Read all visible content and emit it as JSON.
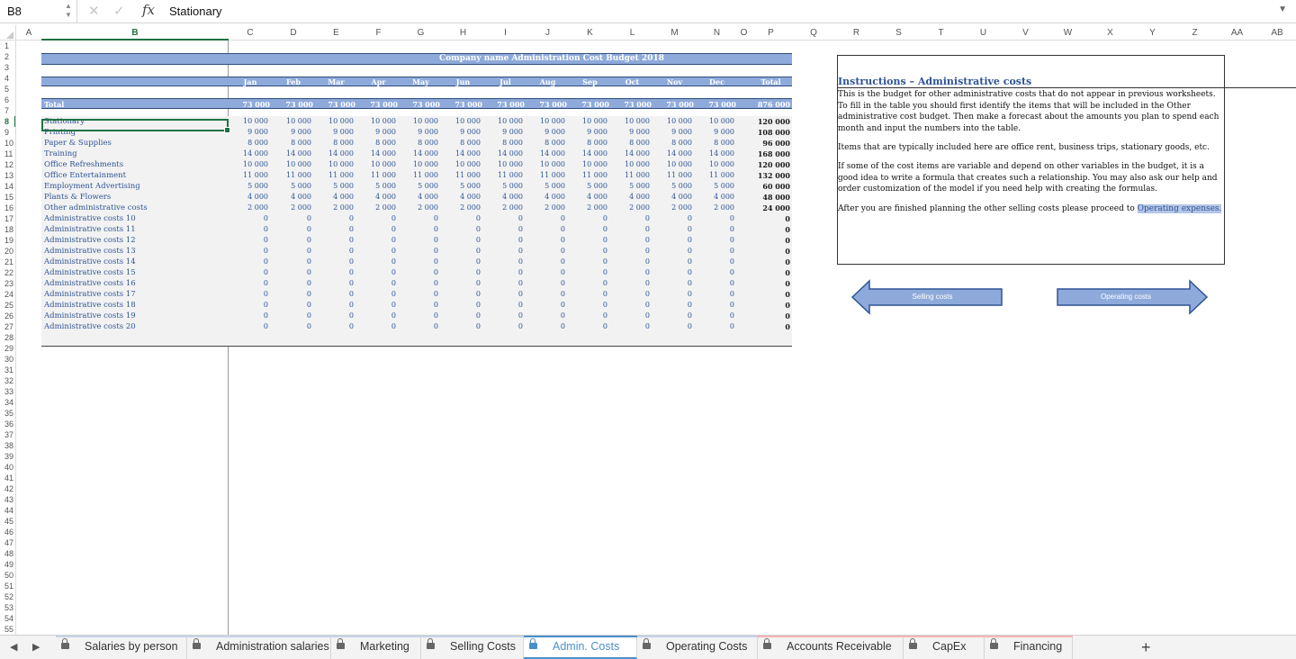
{
  "formula_bar": {
    "name_box": "B8",
    "content": "Stationary",
    "fx": "fx",
    "cancel": "✕",
    "accept": "✓"
  },
  "columns": [
    "A",
    "B",
    "C",
    "D",
    "E",
    "F",
    "G",
    "H",
    "I",
    "J",
    "K",
    "L",
    "M",
    "N",
    "O",
    "P",
    "Q",
    "R",
    "S",
    "T",
    "U",
    "V",
    "W",
    "X",
    "Y",
    "Z",
    "AA",
    "AB"
  ],
  "row_count": 55,
  "selected_cell": {
    "col": "B",
    "row": 8
  },
  "budget": {
    "title": "Company name Administration Cost Budget 2018",
    "months": [
      "Jan",
      "Feb",
      "Mar",
      "Apr",
      "May",
      "Jun",
      "Jul",
      "Aug",
      "Sep",
      "Oct",
      "Nov",
      "Dec"
    ],
    "total_header": "Total",
    "total_row": {
      "label": "Total",
      "values": [
        "73 000",
        "73 000",
        "73 000",
        "73 000",
        "73 000",
        "73 000",
        "73 000",
        "73 000",
        "73 000",
        "73 000",
        "73 000",
        "73 000"
      ],
      "total": "876 000"
    },
    "rows": [
      {
        "label": "Stationary",
        "values": [
          "10 000",
          "10 000",
          "10 000",
          "10 000",
          "10 000",
          "10 000",
          "10 000",
          "10 000",
          "10 000",
          "10 000",
          "10 000",
          "10 000"
        ],
        "total": "120 000"
      },
      {
        "label": "Printing",
        "values": [
          "9 000",
          "9 000",
          "9 000",
          "9 000",
          "9 000",
          "9 000",
          "9 000",
          "9 000",
          "9 000",
          "9 000",
          "9 000",
          "9 000"
        ],
        "total": "108 000"
      },
      {
        "label": "Paper & Supplies",
        "values": [
          "8 000",
          "8 000",
          "8 000",
          "8 000",
          "8 000",
          "8 000",
          "8 000",
          "8 000",
          "8 000",
          "8 000",
          "8 000",
          "8 000"
        ],
        "total": "96 000"
      },
      {
        "label": "Training",
        "values": [
          "14 000",
          "14 000",
          "14 000",
          "14 000",
          "14 000",
          "14 000",
          "14 000",
          "14 000",
          "14 000",
          "14 000",
          "14 000",
          "14 000"
        ],
        "total": "168 000"
      },
      {
        "label": "Office Refreshments",
        "values": [
          "10 000",
          "10 000",
          "10 000",
          "10 000",
          "10 000",
          "10 000",
          "10 000",
          "10 000",
          "10 000",
          "10 000",
          "10 000",
          "10 000"
        ],
        "total": "120 000"
      },
      {
        "label": "Office Entertainment",
        "values": [
          "11 000",
          "11 000",
          "11 000",
          "11 000",
          "11 000",
          "11 000",
          "11 000",
          "11 000",
          "11 000",
          "11 000",
          "11 000",
          "11 000"
        ],
        "total": "132 000"
      },
      {
        "label": "Employment Advertising",
        "values": [
          "5 000",
          "5 000",
          "5 000",
          "5 000",
          "5 000",
          "5 000",
          "5 000",
          "5 000",
          "5 000",
          "5 000",
          "5 000",
          "5 000"
        ],
        "total": "60 000"
      },
      {
        "label": "Plants & Flowers",
        "values": [
          "4 000",
          "4 000",
          "4 000",
          "4 000",
          "4 000",
          "4 000",
          "4 000",
          "4 000",
          "4 000",
          "4 000",
          "4 000",
          "4 000"
        ],
        "total": "48 000"
      },
      {
        "label": "Other administrative costs",
        "values": [
          "2 000",
          "2 000",
          "2 000",
          "2 000",
          "2 000",
          "2 000",
          "2 000",
          "2 000",
          "2 000",
          "2 000",
          "2 000",
          "2 000"
        ],
        "total": "24 000"
      },
      {
        "label": "Administrative costs 10",
        "values": [
          "0",
          "0",
          "0",
          "0",
          "0",
          "0",
          "0",
          "0",
          "0",
          "0",
          "0",
          "0"
        ],
        "total": "0"
      },
      {
        "label": "Administrative costs 11",
        "values": [
          "0",
          "0",
          "0",
          "0",
          "0",
          "0",
          "0",
          "0",
          "0",
          "0",
          "0",
          "0"
        ],
        "total": "0"
      },
      {
        "label": "Administrative costs 12",
        "values": [
          "0",
          "0",
          "0",
          "0",
          "0",
          "0",
          "0",
          "0",
          "0",
          "0",
          "0",
          "0"
        ],
        "total": "0"
      },
      {
        "label": "Administrative costs 13",
        "values": [
          "0",
          "0",
          "0",
          "0",
          "0",
          "0",
          "0",
          "0",
          "0",
          "0",
          "0",
          "0"
        ],
        "total": "0"
      },
      {
        "label": "Administrative costs 14",
        "values": [
          "0",
          "0",
          "0",
          "0",
          "0",
          "0",
          "0",
          "0",
          "0",
          "0",
          "0",
          "0"
        ],
        "total": "0"
      },
      {
        "label": "Administrative costs 15",
        "values": [
          "0",
          "0",
          "0",
          "0",
          "0",
          "0",
          "0",
          "0",
          "0",
          "0",
          "0",
          "0"
        ],
        "total": "0"
      },
      {
        "label": "Administrative costs 16",
        "values": [
          "0",
          "0",
          "0",
          "0",
          "0",
          "0",
          "0",
          "0",
          "0",
          "0",
          "0",
          "0"
        ],
        "total": "0"
      },
      {
        "label": "Administrative costs 17",
        "values": [
          "0",
          "0",
          "0",
          "0",
          "0",
          "0",
          "0",
          "0",
          "0",
          "0",
          "0",
          "0"
        ],
        "total": "0"
      },
      {
        "label": "Administrative costs 18",
        "values": [
          "0",
          "0",
          "0",
          "0",
          "0",
          "0",
          "0",
          "0",
          "0",
          "0",
          "0",
          "0"
        ],
        "total": "0"
      },
      {
        "label": "Administrative costs 19",
        "values": [
          "0",
          "0",
          "0",
          "0",
          "0",
          "0",
          "0",
          "0",
          "0",
          "0",
          "0",
          "0"
        ],
        "total": "0"
      },
      {
        "label": "Administrative costs 20",
        "values": [
          "0",
          "0",
          "0",
          "0",
          "0",
          "0",
          "0",
          "0",
          "0",
          "0",
          "0",
          "0"
        ],
        "total": "0"
      }
    ]
  },
  "instructions": {
    "title": "Instructions – Administrative costs",
    "p1": "This is the budget for other administrative costs that do not appear in previous worksheets. To fill in the table you should first identify the items that will be included in the Other administrative cost budget. Then make a forecast about the amounts you plan to spend each month and input the numbers into the table.",
    "p2": "Items that are typically included here are office rent, business trips, stationary goods, etc.",
    "p3": "If some of the cost items are variable and depend on other variables in the budget, it is a good idea to write a formula that creates such a relationship. You may also ask our help and order customization of the model if you need help with creating the formulas.",
    "p4_prefix": "After you are finished planning the other selling costs please proceed to ",
    "p4_link": "Operating expenses."
  },
  "nav_buttons": {
    "back_label": "Selling costs",
    "forward_label": "Operating costs",
    "fill": "#8eaadb",
    "stroke": "#2f5496"
  },
  "tabs": [
    {
      "label": "Salaries by person",
      "active": false,
      "stripe": "#c7d4ea"
    },
    {
      "label": "Administration salaries",
      "active": false,
      "stripe": "#c7d4ea"
    },
    {
      "label": "Marketing",
      "active": false,
      "stripe": "#c7d4ea"
    },
    {
      "label": "Selling Costs",
      "active": false,
      "stripe": "#c7d4ea"
    },
    {
      "label": "Admin. Costs",
      "active": true,
      "stripe": "#4a90c8"
    },
    {
      "label": "Operating Costs",
      "active": false,
      "stripe": "#c7d4ea"
    },
    {
      "label": "Accounts Receivable",
      "active": false,
      "stripe": "#f4b6b6"
    },
    {
      "label": "CapEx",
      "active": false,
      "stripe": "#f4b6b6"
    },
    {
      "label": "Financing",
      "active": false,
      "stripe": "#f4b6b6"
    }
  ],
  "tab_nav": {
    "prev": "◀",
    "next": "▶",
    "add": "+"
  }
}
